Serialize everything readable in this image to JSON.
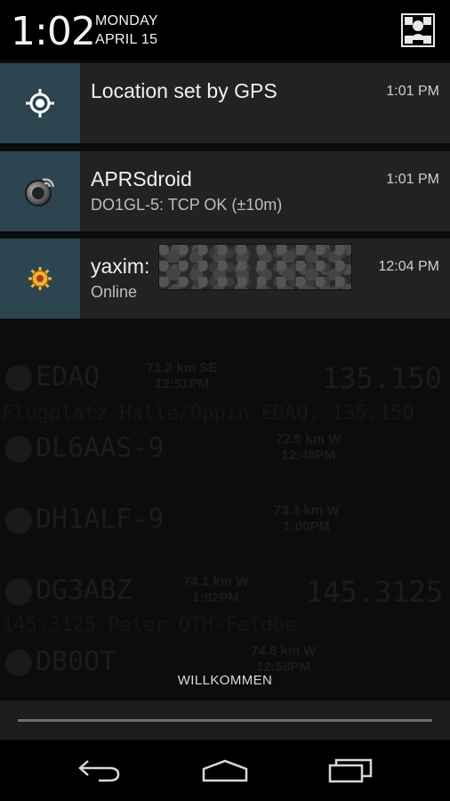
{
  "status": {
    "time": "1:02",
    "day": "MONDAY",
    "date": "APRIL 15",
    "settings_icon": "quick-settings-icon"
  },
  "notifications": [
    {
      "app": "gps",
      "icon": "location-crosshair-icon",
      "title": "Location set by GPS",
      "text": "",
      "time": "1:01 PM"
    },
    {
      "app": "aprsdroid",
      "icon": "aprsdroid-icon",
      "title": "APRSdroid",
      "text": "DO1GL-5: TCP OK (±10m)",
      "time": "1:01 PM"
    },
    {
      "app": "yaxim",
      "icon": "yaxim-icon",
      "title": "yaxim:",
      "text": "Online",
      "time": "12:04 PM"
    }
  ],
  "background_list": [
    {
      "call": "EDAQ",
      "dist": "71.2 km SE",
      "time": "12:51PM",
      "freq": "135.150",
      "sub": "Flugplatz Halle/Oppin EDAQ, 135.150"
    },
    {
      "call": "DL6AAS-9",
      "dist": "72.5 km W",
      "time": "12:48PM",
      "freq": "",
      "sub": ""
    },
    {
      "call": "DH1ALF-9",
      "dist": "73.3 km W",
      "time": "1:00PM",
      "freq": "",
      "sub": ""
    },
    {
      "call": "DG3ABZ",
      "dist": "74.1 km W",
      "time": "1:02PM",
      "freq": "145.3125",
      "sub": "145.3125 Peter QTH-Feldbe"
    },
    {
      "call": "DB0OT",
      "dist": "74.8 km W",
      "time": "12:58PM",
      "freq": "",
      "sub": ""
    }
  ],
  "carrier_label": "WILLKOMMEN",
  "navbar": {
    "back": "back-icon",
    "home": "home-icon",
    "recent": "recent-apps-icon"
  },
  "colors": {
    "icon_box": "#2c4550",
    "notification_bg": "#222222",
    "header_bg": "#000000"
  }
}
